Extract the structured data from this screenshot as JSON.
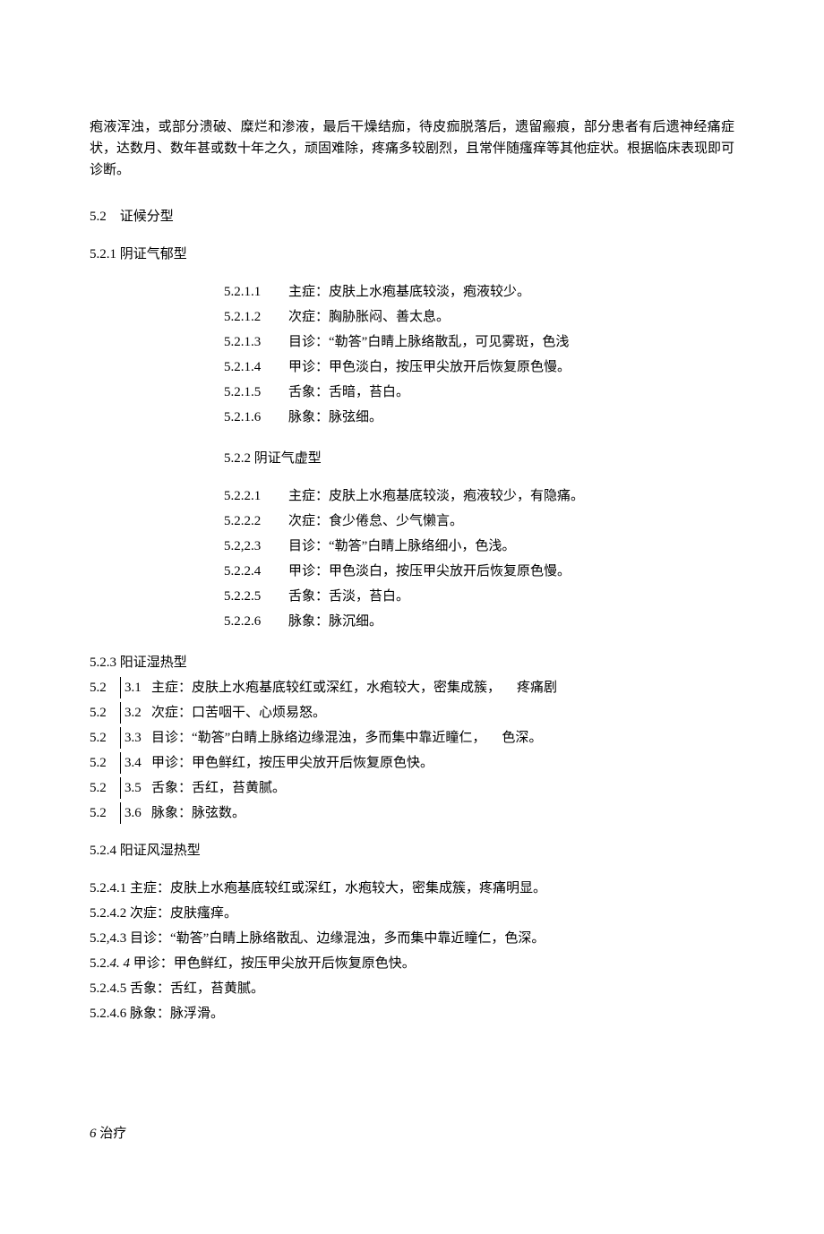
{
  "intro": "疱液浑浊，或部分溃破、糜烂和渗液，最后干燥结痂，待皮痂脱落后，遗留瘢痕，部分患者有后遗神经痛症状，达数月、数年甚或数十年之久，顽固难除，疼痛多较剧烈，且常伴随瘙痒等其他症状。根据临床表现即可诊断。",
  "s52": {
    "num": "5.2",
    "title": "证候分型"
  },
  "s521": {
    "num": "5.2.1",
    "title": "阴证气郁型"
  },
  "s521_items": [
    {
      "num": "5.2.1.1",
      "txt": "主症：皮肤上水疱基底较淡，疱液较少。"
    },
    {
      "num": "5.2.1.2",
      "txt": "次症：胸胁胀闷、善太息。"
    },
    {
      "num": "5.2.1.3",
      "txt": "目诊：“勒答”白睛上脉络散乱，可见雾斑，色浅"
    },
    {
      "num": "5.2.1.4",
      "txt": "甲诊：甲色淡白，按压甲尖放开后恢复原色慢。"
    },
    {
      "num": "5.2.1.5",
      "txt": "舌象：舌暗，苔白。"
    },
    {
      "num": "5.2.1.6",
      "txt": "脉象：脉弦细。"
    }
  ],
  "s522": {
    "num": "5.2.2",
    "title": "阴证气虚型"
  },
  "s522_items": [
    {
      "num": "5.2.2.1",
      "txt": "主症：皮肤上水疱基底较淡，疱液较少，有隐痛。"
    },
    {
      "num": "5.2.2.2",
      "txt": "次症：食少倦怠、少气懒言。"
    },
    {
      "num": "5.2,2.3",
      "txt": "目诊：“勒答”白睛上脉络细小，色浅。"
    },
    {
      "num": "5.2.2.4",
      "txt": "甲诊：甲色淡白，按压甲尖放开后恢复原色慢。"
    },
    {
      "num": "5.2.2.5",
      "txt": "舌象：舌淡，苔白。"
    },
    {
      "num": "5.2.2.6",
      "txt": "脉象：脉沉细。"
    }
  ],
  "s523": {
    "num": "5.2.3",
    "title": "阳证湿热型"
  },
  "s523_items": [
    {
      "p1": "5.2",
      "p2": "3.1",
      "txt_a": "主症：皮肤上水疱基底较红或深红，水疱较大，密集成簇，",
      "txt_b": "疼痛剧"
    },
    {
      "p1": "5.2",
      "p2": "3.2",
      "txt_a": "次症：口苦咽干、心烦易怒。",
      "txt_b": ""
    },
    {
      "p1": "5.2",
      "p2": "3.3",
      "txt_a": "目诊：“勒答”白睛上脉络边缘混浊，多而集中靠近瞳仁，",
      "txt_b": "色深。"
    },
    {
      "p1": "5.2",
      "p2": "3.4",
      "txt_a": "甲诊：甲色鲜红，按压甲尖放开后恢复原色快。",
      "txt_b": ""
    },
    {
      "p1": "5.2",
      "p2": "3.5",
      "txt_a": "舌象：舌红，苔黄腻。",
      "txt_b": ""
    },
    {
      "p1": "5.2",
      "p2": "3.6",
      "txt_a": "脉象：脉弦数。",
      "txt_b": ""
    }
  ],
  "s524": {
    "num": "5.2.4",
    "title": "阳证风湿热型"
  },
  "s524_items": [
    {
      "num": "5.2.4.1",
      "txt": "主症：皮肤上水疱基底较红或深红，水疱较大，密集成簇，疼痛明显。"
    },
    {
      "num": "5.2.4.2",
      "txt": "次症：皮肤瘙痒。"
    },
    {
      "num": "5.2,4.3",
      "txt": "目诊：“勒答”白睛上脉络散乱、边缘混浊，多而集中靠近瞳仁，色深。"
    },
    {
      "num_a": "5.2.",
      "num_b": "4. 4",
      "txt": "甲诊：甲色鲜红，按压甲尖放开后恢复原色快。"
    },
    {
      "num": "5.2.4.5",
      "txt": "舌象：舌红，苔黄腻。"
    },
    {
      "num": "5.2.4.6",
      "txt": "脉象：脉浮滑。"
    }
  ],
  "s6": {
    "num": "6",
    "title": "治疗"
  }
}
